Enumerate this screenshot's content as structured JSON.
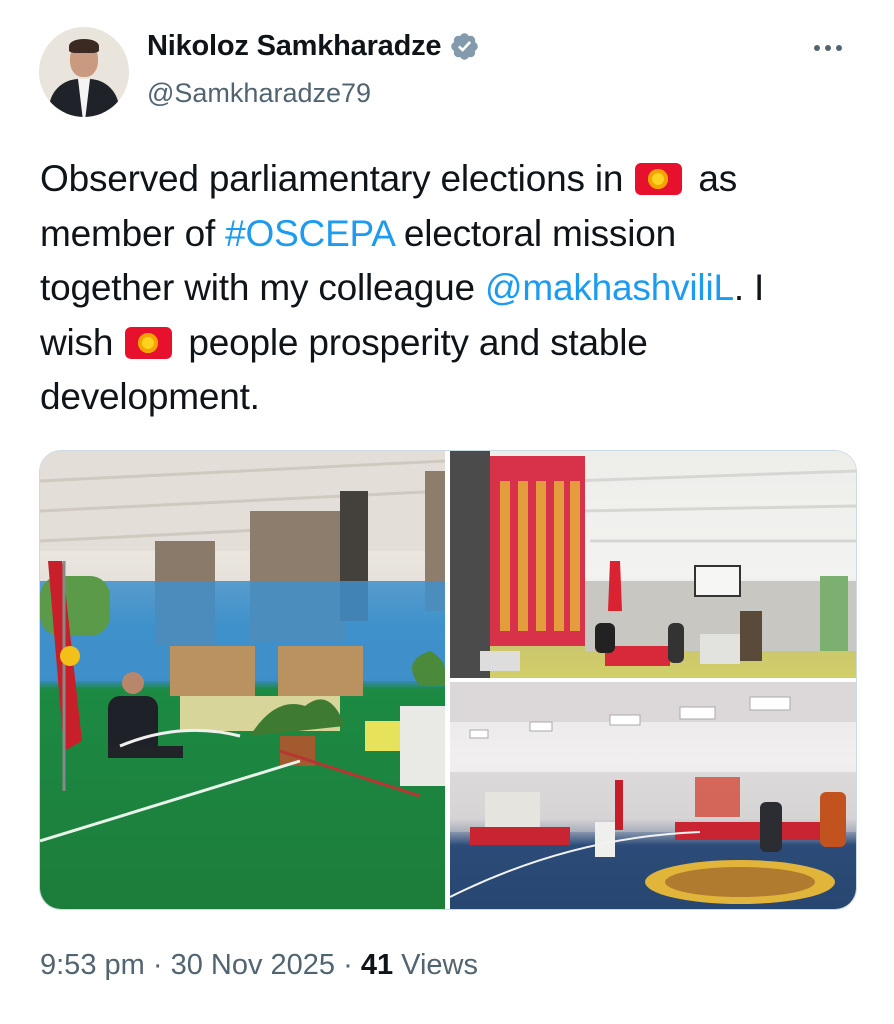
{
  "author": {
    "name": "Nikoloz Samkharadze",
    "handle": "@Samkharadze79",
    "verified": true,
    "avatar_icon": "profile-photo"
  },
  "tweet": {
    "line1_a": "Observed parliamentary elections in ",
    "line1_b": " as",
    "line2_a": "member of ",
    "hashtag": "#OSCEPA",
    "line2_b": " electoral mission",
    "line3_a": "together with my colleague ",
    "mention": "@makhashviliL",
    "line3_b": ". I",
    "line4_a": "wish ",
    "line4_b": " people prosperity and stable",
    "line5": "development.",
    "flag_icon": "kyrgyzstan-flag",
    "link_color": "#1d9bf0"
  },
  "media": {
    "photo_count": 3,
    "photo_icons": [
      "polling-station-photo",
      "gym-hall-photo",
      "voting-hall-photo"
    ]
  },
  "meta": {
    "time": "9:53 pm",
    "sep1": " · ",
    "date": "30 Nov 2025",
    "sep2": " · ",
    "views_count": "41",
    "views_label": " Views"
  },
  "colors": {
    "verified": "#829aab",
    "secondary_text": "#536471"
  }
}
